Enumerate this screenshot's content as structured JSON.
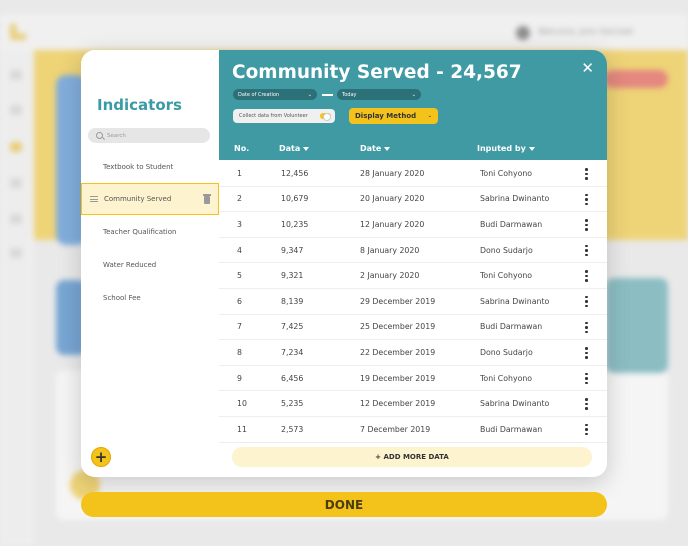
{
  "background": {
    "welcome_text": "Welcome, John Sarmadi"
  },
  "indicators": {
    "title": "Indicators",
    "search_placeholder": "Search",
    "items": [
      {
        "label": "Textbook to Student"
      },
      {
        "label": "Community Served",
        "active": true
      },
      {
        "label": "Teacher Qualification"
      },
      {
        "label": "Water Reduced"
      },
      {
        "label": "School Fee"
      }
    ],
    "add_label": "+"
  },
  "header": {
    "title": "Community Served - 24,567",
    "date_of_creation": "Date of Creation",
    "today": "Today",
    "collect_toggle": "Collect data from Volunteer",
    "display_method": "Display Method",
    "close": "✕"
  },
  "table": {
    "columns": [
      "No.",
      "Data",
      "Date",
      "Inputed by"
    ],
    "rows": [
      {
        "no": "1",
        "data": "12,456",
        "date": "28 January 2020",
        "by": "Toni Cohyono"
      },
      {
        "no": "2",
        "data": "10,679",
        "date": "20 January 2020",
        "by": "Sabrina Dwinanto"
      },
      {
        "no": "3",
        "data": "10,235",
        "date": "12 January 2020",
        "by": "Budi Darmawan"
      },
      {
        "no": "4",
        "data": "9,347",
        "date": "8 January 2020",
        "by": "Dono Sudarjo"
      },
      {
        "no": "5",
        "data": "9,321",
        "date": "2 January 2020",
        "by": "Toni Cohyono"
      },
      {
        "no": "6",
        "data": "8,139",
        "date": "29 December 2019",
        "by": "Sabrina Dwinanto"
      },
      {
        "no": "7",
        "data": "7,425",
        "date": "25 December 2019",
        "by": "Budi Darmawan"
      },
      {
        "no": "8",
        "data": "7,234",
        "date": "22 December 2019",
        "by": "Dono Sudarjo"
      },
      {
        "no": "9",
        "data": "6,456",
        "date": "19 December 2019",
        "by": "Toni Cohyono"
      },
      {
        "no": "10",
        "data": "5,235",
        "date": "12 December 2019",
        "by": "Sabrina Dwinanto"
      },
      {
        "no": "11",
        "data": "2,573",
        "date": "7 December 2019",
        "by": "Budi Darmawan"
      }
    ],
    "add_more_label": "+ ADD MORE DATA"
  },
  "done_label": "DONE",
  "colors": {
    "teal": "#3f9aa4",
    "yellow": "#f3c21b"
  }
}
